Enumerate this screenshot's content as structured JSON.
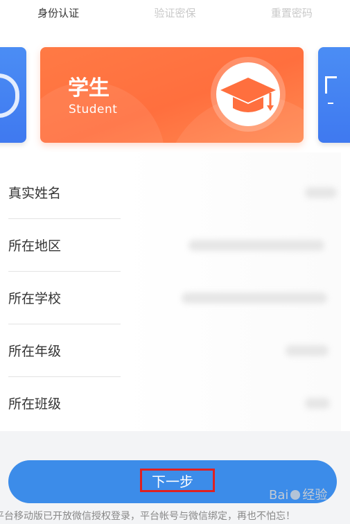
{
  "steps": [
    {
      "label": "身份认证",
      "active": true
    },
    {
      "label": "验证密保",
      "active": false
    },
    {
      "label": "重置密码",
      "active": false
    }
  ],
  "role_card": {
    "title": "学生",
    "subtitle": "Student",
    "icon": "graduation-cap-icon",
    "accent_color": "#ff6f3e"
  },
  "side_cards": {
    "left_color": "#3f79f0",
    "right_color": "#3f79f0"
  },
  "form": {
    "fields": [
      {
        "label": "真实姓名"
      },
      {
        "label": "所在地区"
      },
      {
        "label": "所在学校"
      },
      {
        "label": "所在年级"
      },
      {
        "label": "所在班级"
      }
    ]
  },
  "next_button": {
    "label": "下一步",
    "color": "#3c8ce9"
  },
  "notice": "平台移动版已开放微信授权登录，平台帐号与微信绑定，再也不怕忘！",
  "watermark": {
    "text_left": "Bai",
    "text_right": "经验"
  }
}
